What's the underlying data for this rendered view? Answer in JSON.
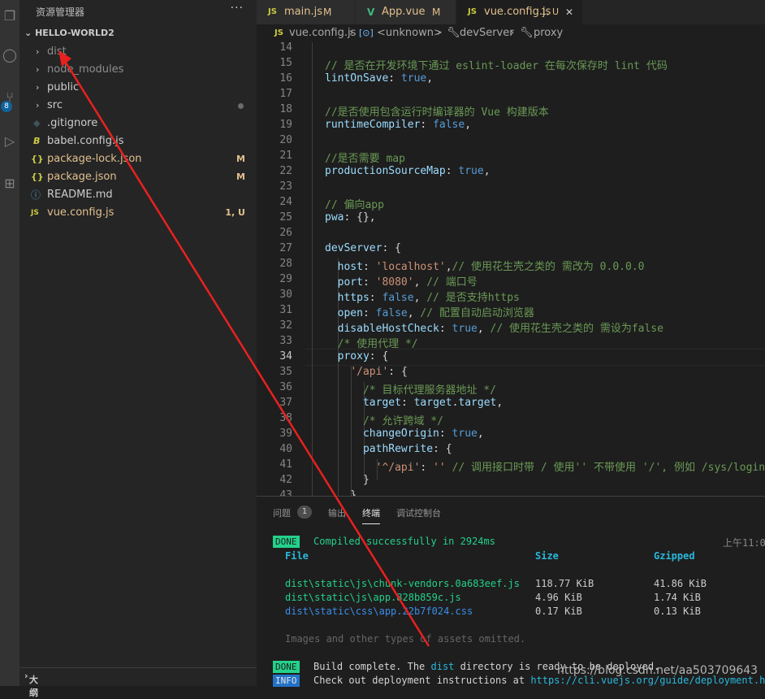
{
  "sidebar": {
    "title": "资源管理器",
    "more": "···",
    "project": "HELLO-WORLD2",
    "items": [
      {
        "label": "dist",
        "kind": "folder"
      },
      {
        "label": "node_modules",
        "kind": "folder"
      },
      {
        "label": "public",
        "kind": "folder"
      },
      {
        "label": "src",
        "kind": "folder"
      },
      {
        "label": ".gitignore",
        "icon": "◆"
      },
      {
        "label": "babel.config.js",
        "icon": "B"
      },
      {
        "label": "package-lock.json",
        "icon": "{}",
        "status": "M"
      },
      {
        "label": "package.json",
        "icon": "{}",
        "status": "M"
      },
      {
        "label": "README.md",
        "icon": "ⓘ"
      },
      {
        "label": "vue.config.js",
        "icon": "JS",
        "status": "1, U"
      }
    ],
    "outline": "大纲"
  },
  "activity": {
    "badge": "8"
  },
  "tabs": [
    {
      "label": "main.js",
      "icon": "JS",
      "status": "M"
    },
    {
      "label": "App.vue",
      "icon": "V",
      "status": "M"
    },
    {
      "label": "vue.config.js",
      "icon": "JS",
      "status": "1, U",
      "close": "✕"
    }
  ],
  "breadcrumb": {
    "file_icon": "JS",
    "file": "vue.config.js",
    "sep": "›",
    "unknown": "<unknown>",
    "devserver": "devServer",
    "proxy": "proxy"
  },
  "editor": {
    "line_numbers": [
      "14",
      "15",
      "16",
      "17",
      "18",
      "19",
      "20",
      "21",
      "22",
      "23",
      "24",
      "25",
      "26",
      "27",
      "28",
      "29",
      "30",
      "31",
      "32",
      "33",
      "34",
      "35",
      "36",
      "37",
      "38",
      "39",
      "40",
      "41",
      "42",
      "43"
    ],
    "lines": [
      "",
      "// 是否在开发环境下通过 eslint-loader 在每次保存时 lint 代码",
      "lintOnSave: true,",
      "",
      "//是否使用包含运行时编译器的 Vue 构建版本",
      "runtimeCompiler: false,",
      "",
      "//是否需要 map",
      "productionSourceMap: true,",
      "",
      "// 偏向app",
      "pwa: {},",
      "",
      "devServer: {",
      "  host: 'localhost',// 使用花生壳之类的 需改为 0.0.0.0",
      "  port: '8080', // 端口号",
      "  https: false, // 是否支持https",
      "  open: false, // 配置自动启动浏览器",
      "  disableHostCheck: true, // 使用花生壳之类的 需设为false",
      "  /* 使用代理 */",
      "  proxy: {",
      "    '/api': {",
      "      /* 目标代理服务器地址 */",
      "      target: target.target,",
      "      /* 允许跨域 */",
      "      changeOrigin: true,",
      "      pathRewrite: {",
      "        '^/api': '' // 调用接口时带 / 使用'' 不带使用 '/', 例如 /sys/login",
      "      }",
      "    }"
    ]
  },
  "panel": {
    "tabs": [
      "问题",
      "输出",
      "终端",
      "调试控制台"
    ],
    "problem_count": "1",
    "terminal": {
      "done1": "DONE",
      "compiled": "Compiled successfully in 2924ms",
      "time": "上午11:0",
      "headers": [
        "File",
        "Size",
        "Gzipped"
      ],
      "rows": [
        [
          "dist\\static\\js\\chunk-vendors.0a683eef.js",
          "118.77 KiB",
          "41.86 KiB"
        ],
        [
          "dist\\static\\js\\app.828b859c.js",
          "4.96 KiB",
          "1.74 KiB"
        ],
        [
          "dist\\static\\css\\app.22b7f024.css",
          "0.17 KiB",
          "0.13 KiB"
        ]
      ],
      "omitted": "Images and other types of assets omitted.",
      "done2": "DONE",
      "build_pre": "Build complete. The ",
      "build_dist": "dist",
      "build_post": " directory is ready to be deployed.",
      "info": "INFO",
      "checkout": "Check out deployment instructions at ",
      "link": "https://cli.vuejs.org/guide/deployment.html"
    }
  },
  "watermark": "https://blog.csdn.net/aa503709643"
}
